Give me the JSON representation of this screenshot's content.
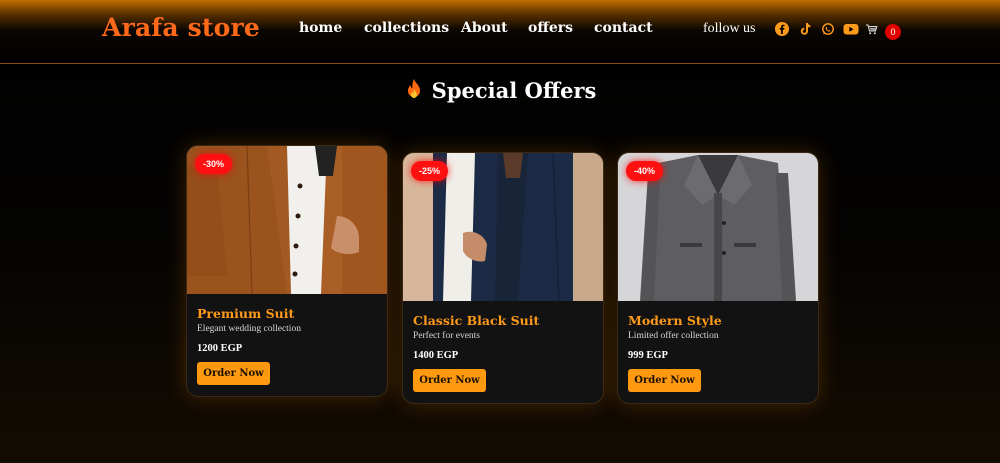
{
  "header": {
    "brand": "Arafa store",
    "nav": [
      "home",
      "collections",
      "About",
      "offers",
      "contact"
    ],
    "follow_label": "follow us",
    "social_icons": [
      "facebook-icon",
      "tiktok-icon",
      "whatsapp-icon",
      "youtube-icon"
    ],
    "cart_count": "0"
  },
  "section": {
    "title": "Special Offers"
  },
  "offers": [
    {
      "discount": "-30%",
      "title": "Premium Suit",
      "description": "Elegant wedding collection",
      "price": "1200 EGP",
      "button": "Order Now"
    },
    {
      "discount": "-25%",
      "title": "Classic Black Suit",
      "description": "Perfect for events",
      "price": "1400 EGP",
      "button": "Order Now"
    },
    {
      "discount": "-40%",
      "title": "Modern Style",
      "description": "Limited offer collection",
      "price": "999 EGP",
      "button": "Order Now"
    }
  ],
  "colors": {
    "accent": "#ff9a1a",
    "brand": "#ff6a1a",
    "badge": "#ff1010",
    "button": "#ff9a10"
  }
}
